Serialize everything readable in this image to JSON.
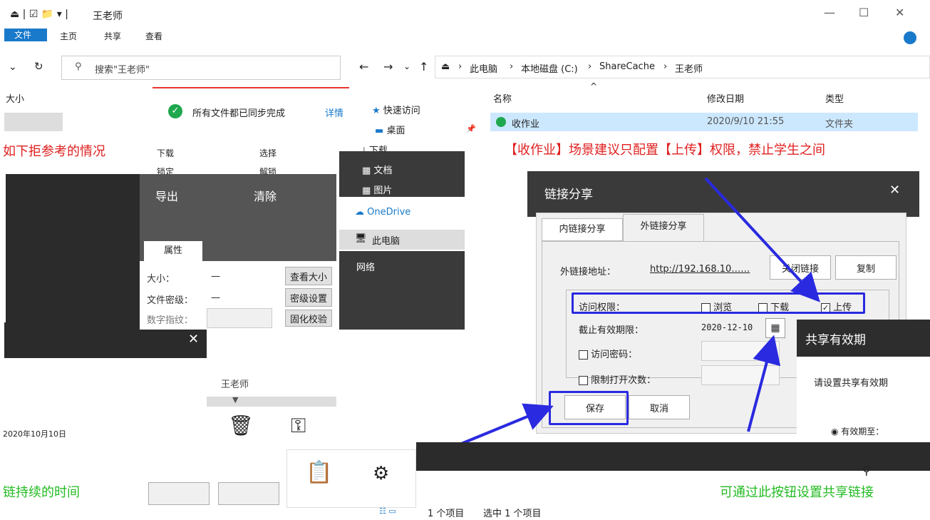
{
  "window": {
    "title": "王老师",
    "menu_file": "文件",
    "menu_home": "主页",
    "menu_share": "共享",
    "menu_view": "查看"
  },
  "controls": {
    "minimize": "—",
    "maximize": "☐",
    "close": "✕"
  },
  "left_pane": {
    "search_placeholder": "搜索\"王老师\"",
    "col_size": "大小",
    "red_text": "如下拒参考的情况",
    "green_text": "链持续的时间"
  },
  "sync_panel": {
    "status": "所有文件都已同步完成",
    "detail": "详情",
    "menu_download": "下载",
    "menu_select": "选择",
    "menu_lock": "锁定",
    "menu_unlock": "解锁",
    "menu_more1": "导出",
    "menu_more2": "清除"
  },
  "props": {
    "tab": "属性",
    "size_label": "大小：",
    "size_val": "—",
    "size_btn": "查看大小",
    "sec_label": "文件密级：",
    "sec_val": "—",
    "sec_btn": "密级设置",
    "fp_label": "数字指纹：",
    "fp_btn": "固化校验",
    "owner": "王老师",
    "bottom_date": "2020年10月10日"
  },
  "nav": {
    "breadcrumb": [
      "此电脑",
      "本地磁盘 (C:)",
      "ShareCache",
      "王老师"
    ],
    "quick_access": "快速访问",
    "desktop": "桌面",
    "downloads": "下载",
    "docs": "文档",
    "pictures": "图片",
    "onedrive": "OneDrive",
    "this_pc": "此电脑",
    "network": "网络"
  },
  "files": {
    "col_name": "名称",
    "col_date": "修改日期",
    "col_type": "类型",
    "row_name": "收作业",
    "row_date": "2020/9/10 21:55",
    "row_type": "文件夹"
  },
  "annotation_red": "【收作业】场景建议只配置【上传】权限，禁止学生之间",
  "dialog": {
    "title": "链接分享",
    "tab_internal": "内链接分享",
    "tab_external": "外链接分享",
    "link_label": "外链接地址：",
    "link_url": "http://192.168.10……",
    "btn_close_link": "关闭链接",
    "btn_copy": "复制",
    "perm_label": "访问权限：",
    "perm_view": "浏览",
    "perm_download": "下载",
    "perm_upload": "上传",
    "expire_label": "截止有效期限：",
    "expire_val": "2020-12-10",
    "pwd_label": "访问密码：",
    "limit_label": "限制打开次数：",
    "btn_save": "保存",
    "btn_cancel": "取消"
  },
  "validity": {
    "title": "共享有效期",
    "desc": "请设置共享有效期",
    "option": "有效期至："
  },
  "statusbar": {
    "items": "1 个项目",
    "selected": "选中 1 个项目"
  },
  "bottom_green": "可通过此按钮设置共享链接"
}
